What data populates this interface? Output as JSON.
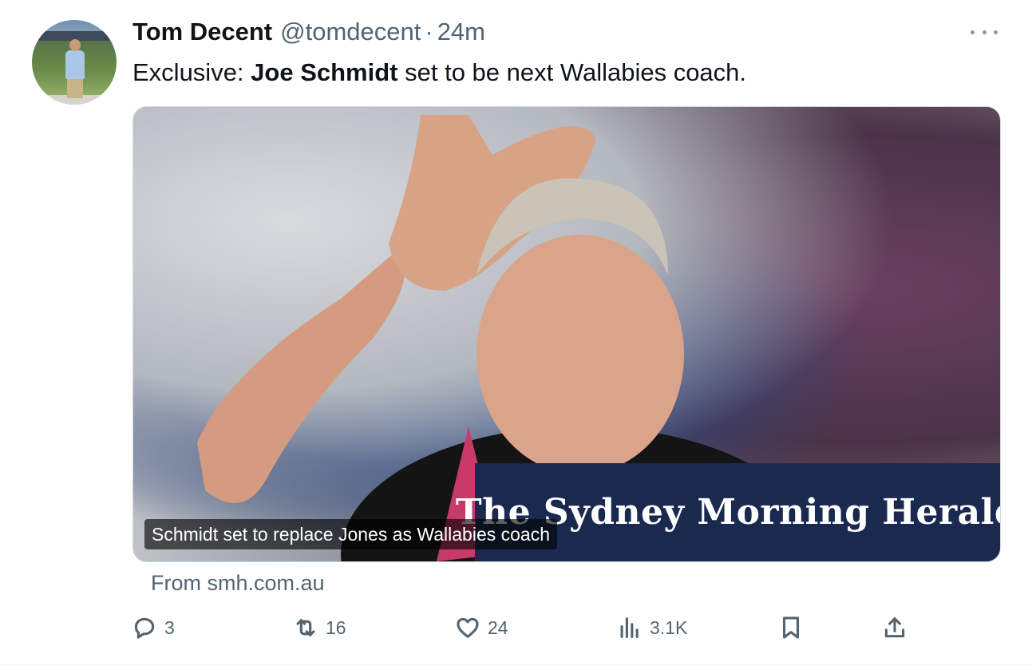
{
  "tweet": {
    "author_name": "Tom Decent",
    "handle": "@tomdecent",
    "separator": "·",
    "time": "24m",
    "text_prefix": "Exclusive: ",
    "text_bold": "Joe Schmidt",
    "text_suffix": " set to be next Wallabies coach.",
    "media": {
      "brand_text": "The Sydney Morning Herald",
      "caption": "Schmidt set to replace Jones as Wallabies coach"
    },
    "source": "From smh.com.au",
    "stats": {
      "replies": "3",
      "retweets": "16",
      "likes": "24",
      "views": "3.1K"
    }
  },
  "icons": {
    "more": "more-horizontal-icon",
    "reply": "reply-icon",
    "retweet": "retweet-icon",
    "like": "heart-icon",
    "views": "analytics-icon",
    "bookmark": "bookmark-icon",
    "share": "share-icon"
  },
  "colors": {
    "text_primary": "#0f1419",
    "text_secondary": "#536471",
    "brand_bar": "#1a2a4f"
  }
}
